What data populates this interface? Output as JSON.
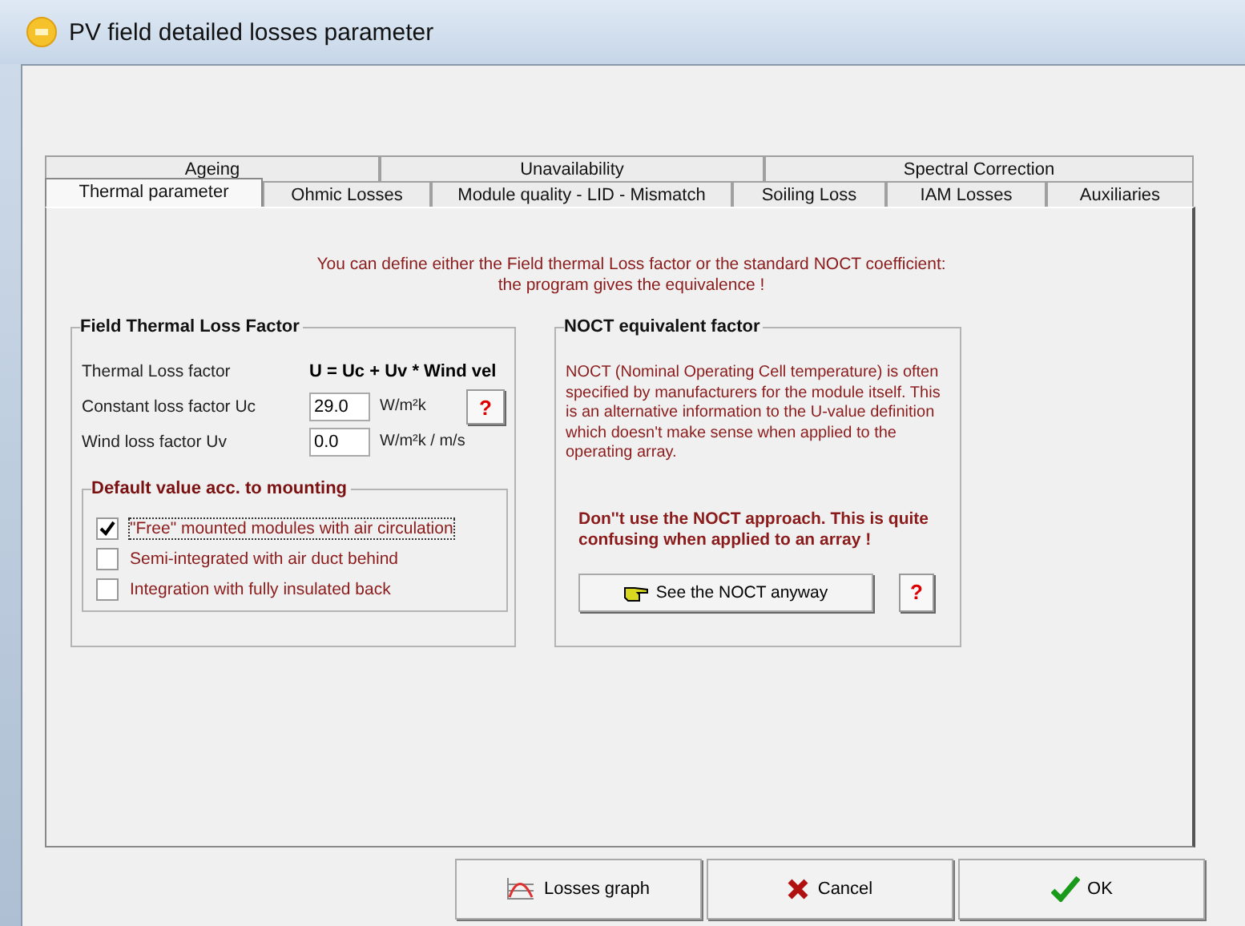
{
  "window": {
    "title": "PV field detailed losses parameter"
  },
  "tabs": [
    [
      {
        "label": "Ageing",
        "selected": false
      },
      {
        "label": "Unavailability",
        "selected": false
      },
      {
        "label": "Spectral Correction",
        "selected": false
      }
    ],
    [
      {
        "label": "Thermal parameter",
        "selected": true
      },
      {
        "label": "Ohmic Losses",
        "selected": false
      },
      {
        "label": "Module quality - LID - Mismatch",
        "selected": false
      },
      {
        "label": "Soiling Loss",
        "selected": false
      },
      {
        "label": "IAM Losses",
        "selected": false
      },
      {
        "label": "Auxiliaries",
        "selected": false
      }
    ]
  ],
  "intro": [
    "You can define either the Field thermal Loss factor or the standard NOCT coefficient:",
    "the program gives the equivalence !"
  ],
  "thermal": {
    "title": "Field Thermal Loss Factor",
    "formula_label": "Thermal Loss factor",
    "formula": "U = Uc + Uv * Wind vel",
    "fields": [
      {
        "label": "Constant loss factor  Uc",
        "value": "29.0",
        "unit": "W/m²k",
        "help": "?"
      },
      {
        "label": "Wind loss factor  Uv",
        "value": "0.0",
        "unit": "W/m²k / m/s"
      }
    ],
    "mounting": {
      "title": "Default value acc. to mounting",
      "options": [
        {
          "label": "\"Free\" mounted modules with air circulation",
          "checked": true,
          "focused": true
        },
        {
          "label": "Semi-integrated with air duct behind",
          "checked": false,
          "focused": false
        },
        {
          "label": "Integration with fully insulated back",
          "checked": false,
          "focused": false
        }
      ]
    }
  },
  "noct": {
    "title": "NOCT equivalent factor",
    "text": "NOCT  (Nominal Operating Cell temperature) is often specified by manufacturers  for the module itself. This is an alternative information to the U-value definition which doesn't make sense when applied to the operating array.",
    "warning": "Don''t use the NOCT approach. This is quite confusing when applied to an array !",
    "button": "See the NOCT anyway",
    "help": "?"
  },
  "buttons": [
    {
      "kind": "graph",
      "label": "Losses graph"
    },
    {
      "kind": "cancel",
      "label": "Cancel"
    },
    {
      "kind": "ok",
      "label": "OK"
    }
  ]
}
